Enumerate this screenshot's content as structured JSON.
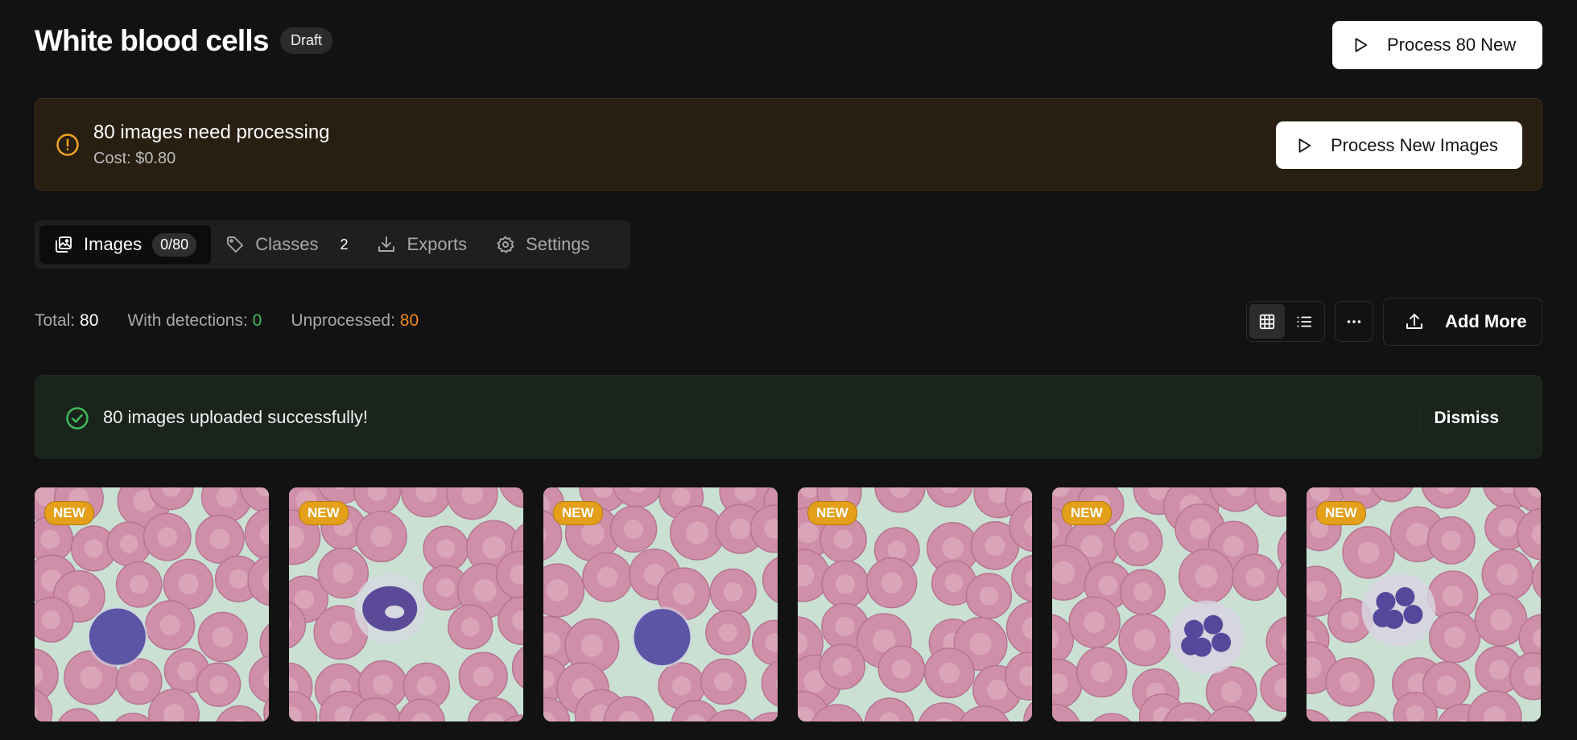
{
  "header": {
    "title": "White blood cells",
    "status_badge": "Draft",
    "process_button_label": "Process 80 New"
  },
  "alert": {
    "title": "80 images need processing",
    "cost": "Cost: $0.80",
    "button_label": "Process New Images",
    "accent_color": "#f0a21b"
  },
  "tabs": [
    {
      "label": "Images",
      "count": "0/80",
      "icon": "images-icon",
      "active": true
    },
    {
      "label": "Classes",
      "count": "2",
      "icon": "tag-icon",
      "active": false
    },
    {
      "label": "Exports",
      "icon": "download-icon",
      "active": false
    },
    {
      "label": "Settings",
      "icon": "gear-icon",
      "active": false
    }
  ],
  "stats": {
    "total_label": "Total:",
    "total_value": "80",
    "detections_label": "With detections:",
    "detections_value": "0",
    "unprocessed_label": "Unprocessed:",
    "unprocessed_value": "80",
    "detections_color": "#3fba5a",
    "unprocessed_color": "#f08a1f"
  },
  "toolbar": {
    "view_mode": "grid",
    "view_icons": [
      "grid-icon",
      "list-icon"
    ],
    "more_icon": "ellipsis-icon",
    "add_more_label": "Add More"
  },
  "success_banner": {
    "message": "80 images uploaded successfully!",
    "dismiss_label": "Dismiss",
    "accent_color": "#3fba5a"
  },
  "images": [
    {
      "badge": "NEW",
      "cell_type": "lymphocyte"
    },
    {
      "badge": "NEW",
      "cell_type": "monocyte"
    },
    {
      "badge": "NEW",
      "cell_type": "lymphocyte"
    },
    {
      "badge": "NEW",
      "cell_type": "red-cells-only"
    },
    {
      "badge": "NEW",
      "cell_type": "neutrophil"
    },
    {
      "badge": "NEW",
      "cell_type": "neutrophil"
    }
  ]
}
